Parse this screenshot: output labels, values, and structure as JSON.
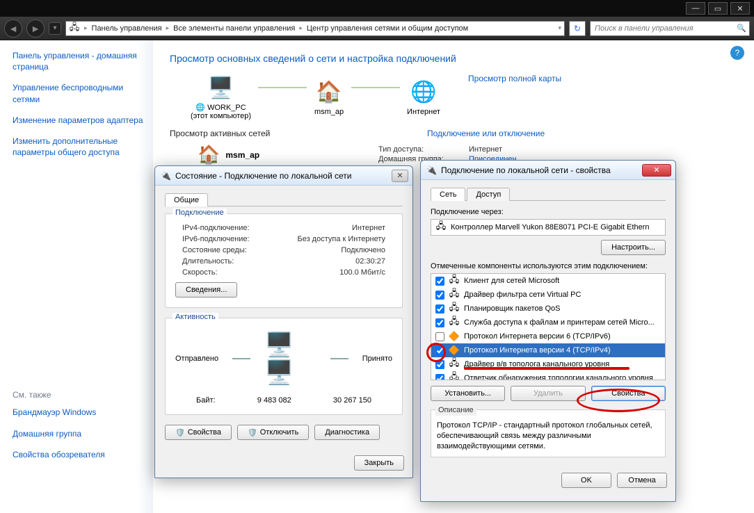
{
  "window_controls": {
    "min": "—",
    "max": "▭",
    "close": "✕"
  },
  "nav": {
    "back": "◄",
    "fwd": "►",
    "dd": "▾",
    "crumbs": [
      "Панель управления",
      "Все элементы панели управления",
      "Центр управления сетями и общим доступом"
    ],
    "refresh": "↻",
    "search_placeholder": "Поиск в панели управления",
    "search_icon": "🔍"
  },
  "sidebar": {
    "links": [
      "Панель управления - домашняя страница",
      "Управление беспроводными сетями",
      "Изменение параметров адаптера",
      "Изменить дополнительные параметры общего доступа"
    ],
    "see_also_hdr": "См. также",
    "see_also": [
      "Брандмауэр Windows",
      "Домашняя группа",
      "Свойства обозревателя"
    ]
  },
  "content": {
    "heading": "Просмотр основных сведений о сети и настройка подключений",
    "nodes": {
      "pc": "WORK_PC",
      "pc_sub": "(этот компьютер)",
      "router": "msm_ap",
      "inet": "Интернет"
    },
    "view_full_map": "Просмотр полной карты",
    "active_hdr": "Просмотр активных сетей",
    "connect_link": "Подключение или отключение",
    "net_name": "msm_ap",
    "access_type_k": "Тип доступа:",
    "access_type_v": "Интернет",
    "homegroup_k": "Домашняя группа:",
    "homegroup_v": "Присоединен"
  },
  "status_dlg": {
    "title": "Состояние - Подключение по локальной сети",
    "tab_general": "Общие",
    "grp_conn": "Подключение",
    "rows": {
      "ipv4_k": "IPv4-подключение:",
      "ipv4_v": "Интернет",
      "ipv6_k": "IPv6-подключение:",
      "ipv6_v": "Без доступа к Интернету",
      "media_k": "Состояние среды:",
      "media_v": "Подключено",
      "dur_k": "Длительность:",
      "dur_v": "02:30:27",
      "spd_k": "Скорость:",
      "spd_v": "100.0 Мбит/с"
    },
    "btn_details": "Сведения...",
    "grp_act": "Активность",
    "sent": "Отправлено",
    "recv": "Принято",
    "bytes_k": "Байт:",
    "bytes_sent": "9 483 082",
    "bytes_recv": "30 267 150",
    "btn_props": "Свойства",
    "btn_disable": "Отключить",
    "btn_diag": "Диагностика",
    "btn_close": "Закрыть"
  },
  "props_dlg": {
    "title": "Подключение по локальной сети - свойства",
    "tab_net": "Сеть",
    "tab_access": "Доступ",
    "connect_using": "Подключение через:",
    "adapter": "Контроллер Marvell Yukon 88E8071 PCI-E Gigabit Ethern",
    "btn_configure": "Настроить...",
    "components_label": "Отмеченные компоненты используются этим подключением:",
    "components": [
      {
        "checked": true,
        "label": "Клиент для сетей Microsoft"
      },
      {
        "checked": true,
        "label": "Драйвер фильтра сети Virtual PC"
      },
      {
        "checked": true,
        "label": "Планировщик пакетов QoS"
      },
      {
        "checked": true,
        "label": "Служба доступа к файлам и принтерам сетей Micro..."
      },
      {
        "checked": false,
        "label": "Протокол Интернета версии 6 (TCP/IPv6)"
      },
      {
        "checked": true,
        "label": "Протокол Интернета версии 4 (TCP/IPv4)",
        "selected": true
      },
      {
        "checked": true,
        "label": "Драйвер в/в тополога канального уровня"
      },
      {
        "checked": true,
        "label": "Ответчик обнаружения топологии канального уровня"
      }
    ],
    "btn_install": "Установить...",
    "btn_remove": "Удалить",
    "btn_item_props": "Свойства",
    "desc_hdr": "Описание",
    "desc": "Протокол TCP/IP - стандартный протокол глобальных сетей, обеспечивающий связь между различными взаимодействующими сетями.",
    "btn_ok": "OK",
    "btn_cancel": "Отмена"
  }
}
